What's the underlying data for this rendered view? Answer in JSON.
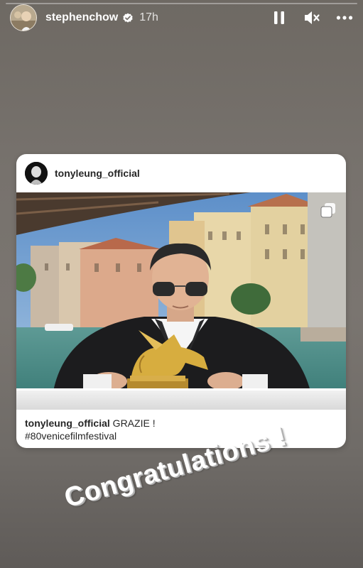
{
  "story": {
    "progress": 0.0,
    "username": "stephenchow",
    "time_ago": "17h",
    "icons": {
      "verified": "verified-badge-icon",
      "pause": "pause-icon",
      "mute": "mute-icon",
      "more": "more-icon"
    }
  },
  "post": {
    "username": "tonyleung_official",
    "caption_user": "tonyleung_official",
    "caption_text": " GRAZIE !",
    "hashtag": "#80venicefilmfestival",
    "photo_icon": "multiple-photos-icon"
  },
  "sticker": {
    "text": "Congratulations !"
  },
  "colors": {
    "background": "#77726d",
    "card": "#ffffff",
    "text": "#262626"
  }
}
